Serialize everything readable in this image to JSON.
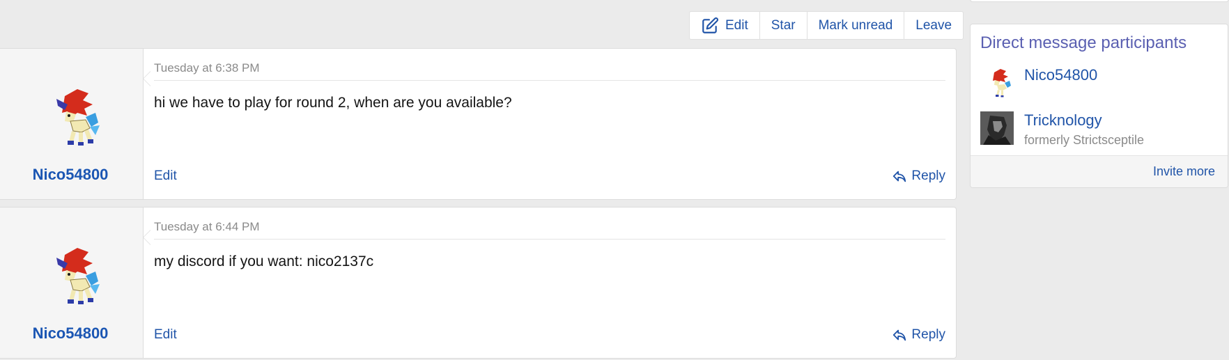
{
  "toolbar": {
    "edit_label": "Edit",
    "star_label": "Star",
    "mark_unread_label": "Mark unread",
    "leave_label": "Leave"
  },
  "messages": [
    {
      "username": "Nico54800",
      "timestamp": "Tuesday at 6:38 PM",
      "text": "hi we have to play for round 2, when are you available?",
      "edit_label": "Edit",
      "reply_label": "Reply"
    },
    {
      "username": "Nico54800",
      "timestamp": "Tuesday at 6:44 PM",
      "text": "my discord if you want: nico2137c",
      "edit_label": "Edit",
      "reply_label": "Reply"
    }
  ],
  "sidebar": {
    "title": "Direct message participants",
    "participants": [
      {
        "name": "Nico54800",
        "avatar_icon": "keldeo-sprite-icon"
      },
      {
        "name": "Tricknology",
        "subtitle": "formerly Strictsceptile",
        "avatar_icon": "dark-figure-avatar"
      }
    ],
    "invite_label": "Invite more"
  },
  "colors": {
    "link": "#2054a8",
    "username": "#1b56b3",
    "sidebar_title": "#5a5fb1",
    "background": "#ebebeb"
  }
}
